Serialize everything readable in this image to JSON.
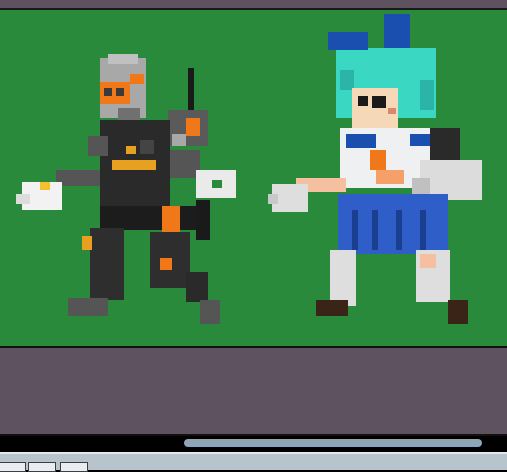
{
  "scene": {
    "characters": [
      {
        "name": "armored-fighter"
      },
      {
        "name": "sailor-uniform-fighter"
      }
    ]
  },
  "colors": {
    "stage_bg": "#2a8a3c",
    "panel_bg": "#5f5260",
    "scroll_thumb": "#8da5b6",
    "bottom_bar": "#b8c4cc"
  },
  "bottom_bar": {
    "slots": [
      "",
      "",
      ""
    ]
  }
}
